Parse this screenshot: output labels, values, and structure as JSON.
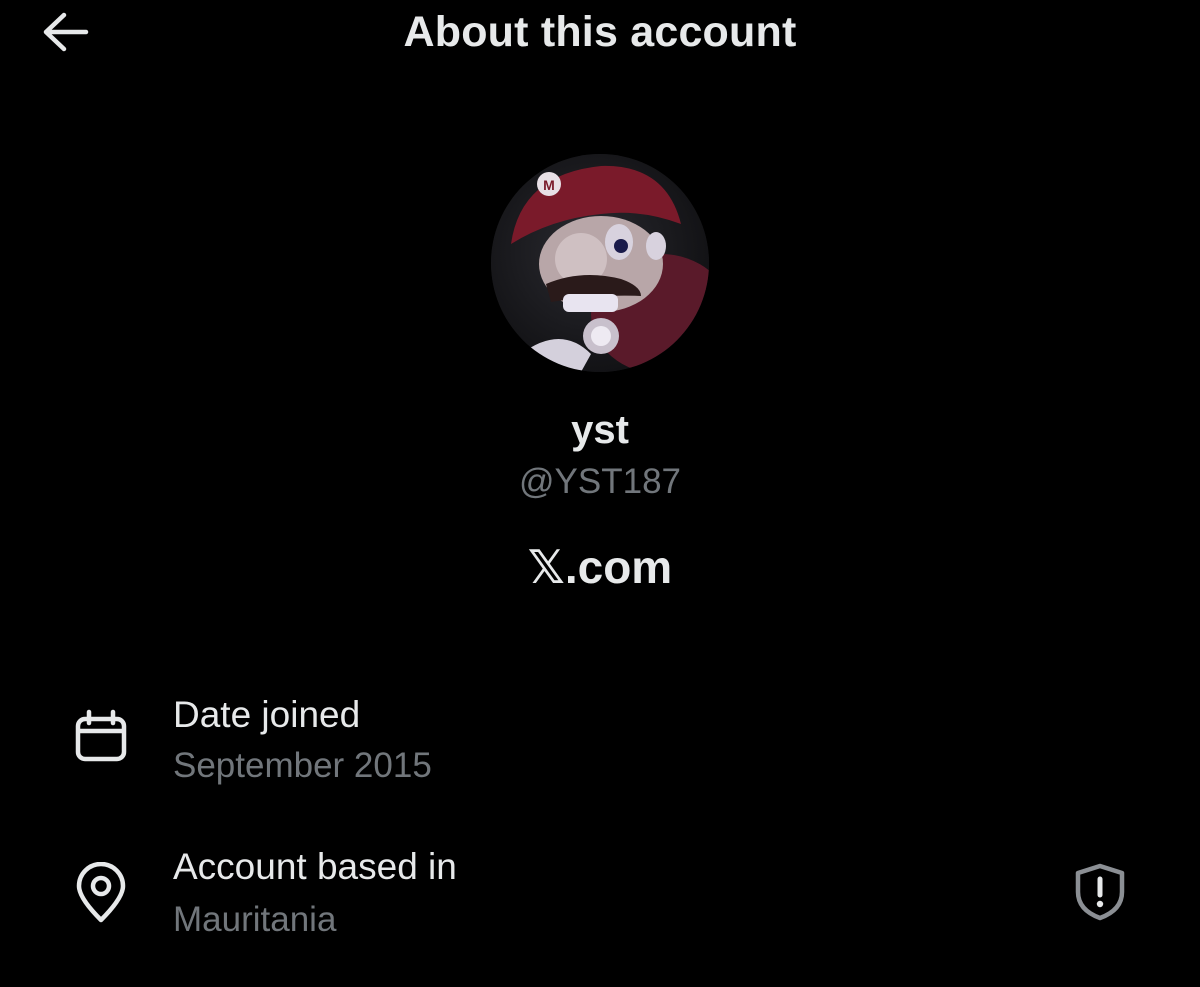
{
  "header": {
    "title": "About this account",
    "back_icon": "arrow-left-icon"
  },
  "profile": {
    "display_name": "yst",
    "handle": "@YST187",
    "platform": "𝕏.com",
    "avatar_icon": "profile-photo"
  },
  "details": [
    {
      "label": "Date joined",
      "value": "September 2015",
      "icon": "calendar-icon"
    },
    {
      "label": "Account based in",
      "value": "Mauritania",
      "icon": "location-pin-icon"
    }
  ],
  "colors": {
    "background": "#000000",
    "primary_text": "#e7e9ea",
    "secondary_text": "#71767b"
  }
}
